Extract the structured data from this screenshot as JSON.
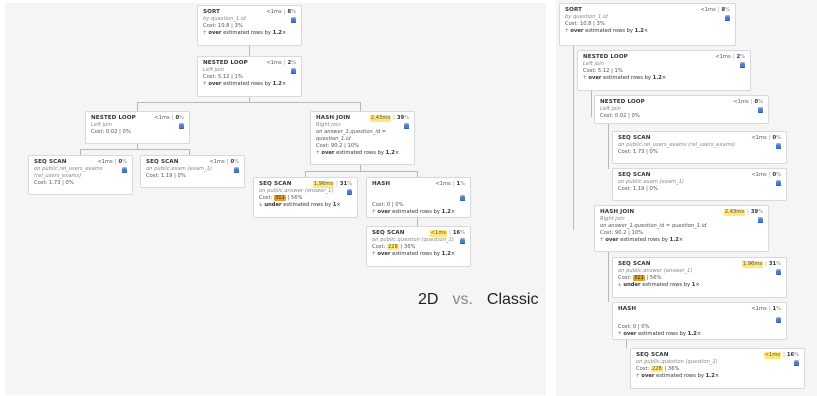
{
  "caption": {
    "left": "2D",
    "vs": "vs.",
    "right": "Classic"
  },
  "est_label": "estimated rows by",
  "nodes": {
    "sort": {
      "title": "SORT",
      "time": "<1ms",
      "pct": "8",
      "sub": "by question_1.id",
      "cost": "Cost: 10.8 | 3%",
      "dir": "over",
      "factor": "1.2"
    },
    "nl_top": {
      "title": "NESTED LOOP",
      "time": "<1ms",
      "pct": "2",
      "sub": "Left join",
      "cost": "Cost: 5.12 | 1%",
      "dir": "over",
      "factor": "1.2"
    },
    "nl_left": {
      "title": "NESTED LOOP",
      "time": "<1ms",
      "pct": "0",
      "sub": "Left join",
      "cost": "Cost: 0.02 | 0%"
    },
    "hash_join": {
      "title": "HASH JOIN",
      "time": "2,43ms",
      "pct": "39",
      "sub": "Right join",
      "sub2": "on answer_1.question_id = question_1.id",
      "cost": "Cost: 90.2 | 10%",
      "dir": "over",
      "factor": "1.2"
    },
    "seq_rue": {
      "title": "SEQ SCAN",
      "time": "<1ms",
      "pct": "0",
      "sub": "on public.rel_users_exams (rel_users_exams)",
      "cost": "Cost: 1.73 | 0%"
    },
    "seq_exam": {
      "title": "SEQ SCAN",
      "time": "<1ms",
      "pct": "0",
      "sub": "on public.exam (exam_1)",
      "cost": "Cost: 1.19 | 0%"
    },
    "seq_answer": {
      "title": "SEQ SCAN",
      "time": "1,96ms",
      "pct": "31",
      "sub": "on public.answer (answer_1)",
      "cost_pre": "Cost:",
      "cost_hl": "311",
      "cost_post": "| 56%",
      "dir": "under",
      "factor": "1"
    },
    "hash": {
      "title": "HASH",
      "time": "<1ms",
      "pct": "1",
      "cost": "Cost: 0 | 0%",
      "dir": "over",
      "factor": "1.2"
    },
    "seq_question": {
      "title": "SEQ SCAN",
      "time": "<1ms",
      "pct": "16",
      "sub": "on public.question (question_1)",
      "cost_pre": "Cost:",
      "cost_hl": "228",
      "cost_post": "| 36%",
      "dir": "over",
      "factor": "1.2"
    }
  },
  "colors": {
    "highlight": "#ffe87a",
    "highlight_strong": "#f0a020",
    "db_icon": "#4a7bd0",
    "connector": "#b8b8b8"
  }
}
